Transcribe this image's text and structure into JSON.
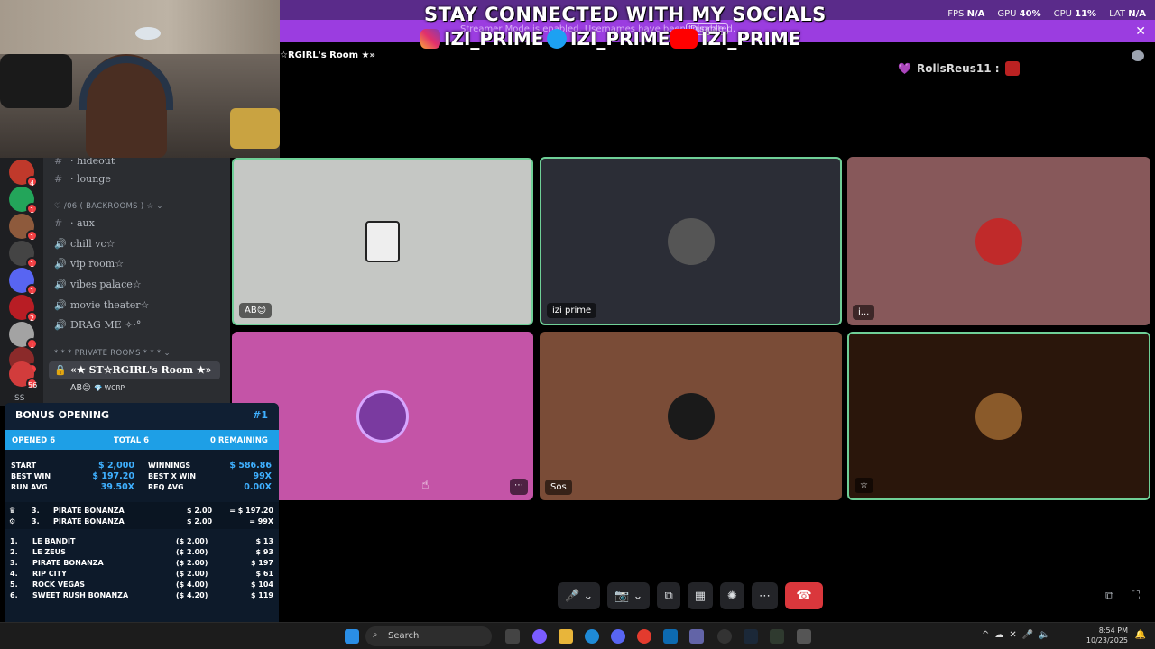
{
  "banner": {
    "title": "STAY CONNECTED WITH MY SOCIALS",
    "streamer_msg": "Streamer Mode is enabled. Usernames have been truncated.",
    "disable_label": "Disable",
    "socials": [
      "IZI_PRIME",
      "IZI_PRIME",
      "IZI_PRIME"
    ],
    "close_icon": "✕"
  },
  "stats": {
    "fps_label": "FPS",
    "fps_val": "N/A",
    "gpu_label": "GPU",
    "gpu_val": "40%",
    "cpu_label": "CPU",
    "cpu_val": "11%",
    "lat_label": "LAT",
    "lat_val": "N/A"
  },
  "server_rail": {
    "badges": [
      "4",
      "1",
      "1",
      "1",
      "1",
      "2",
      "1",
      "1",
      "56"
    ],
    "label": "SS"
  },
  "channels": {
    "items": [
      {
        "glyph": "#",
        "label": "· hideout"
      },
      {
        "glyph": "#",
        "label": "· lounge"
      },
      {
        "glyph": "#",
        "label": "· aux"
      },
      {
        "glyph": "🔊",
        "label": "chill vc☆"
      },
      {
        "glyph": "🔊",
        "label": "vip room☆"
      },
      {
        "glyph": "🔊",
        "label": "vibes palace☆"
      },
      {
        "glyph": "🔊",
        "label": "movie theater☆"
      },
      {
        "glyph": "🔊",
        "label": "DRAG ME ✧·°"
      }
    ],
    "cat_backrooms": "♡ /06 ( BACKROOMS ) ☆ ⌄",
    "cat_private": "* * * PRIVATE ROOMS * * * ⌄",
    "active_room": "«★ ST☆RGIRL's Room ★»",
    "member_name": "AB😊",
    "member_tag": "💎 WCRP"
  },
  "room_title": "☆RGIRL's Room ★»",
  "chat": {
    "user": "RollsReus11 :",
    "prefix": "💜"
  },
  "tiles": [
    {
      "name": "AB😊",
      "bg": "#c5c7c4"
    },
    {
      "name": "izi prime",
      "bg": "#2b2d36"
    },
    {
      "name": "i...",
      "bg": "#87585a"
    },
    {
      "name": "",
      "bg": "#c454a7"
    },
    {
      "name": "Sos",
      "bg": "#7a4c37"
    },
    {
      "name": "☆",
      "bg": "#2a160b"
    }
  ],
  "controls": {
    "mic_icon": "🎤",
    "video_icon": "📷",
    "share_icon": "⧉",
    "activity_icon": "▦",
    "soundboard_icon": "✺",
    "more_icon": "⋯",
    "hangup_icon": "☎",
    "popout_icon": "⧉",
    "fullscreen_icon": "⛶"
  },
  "bonus": {
    "title": "BONUS OPENING",
    "number": "#1",
    "opened": "OPENED 6",
    "total": "TOTAL 6",
    "remaining": "0 REMAINING",
    "stats": {
      "start_label": "START",
      "start_val": "$ 2,000",
      "winnings_label": "WINNINGS",
      "winnings_val": "$ 586.86",
      "bestwin_label": "BEST WIN",
      "bestwin_val": "$ 197.20",
      "bestx_label": "BEST X WIN",
      "bestx_val": "99X",
      "runavg_label": "RUN AVG",
      "runavg_val": "39.50X",
      "reqavg_label": "REQ AVG",
      "reqavg_val": "0.00X"
    },
    "best": [
      {
        "num": "3.",
        "name": "PIRATE BONANZA",
        "bet": "$ 2.00",
        "res": "= $ 197.20"
      },
      {
        "num": "3.",
        "name": "PIRATE BONANZA",
        "bet": "$ 2.00",
        "res": "= 99X"
      }
    ],
    "list": [
      {
        "num": "1.",
        "name": "LE BANDIT",
        "bet": "($ 2.00)",
        "win": "$ 13"
      },
      {
        "num": "2.",
        "name": "LE ZEUS",
        "bet": "($ 2.00)",
        "win": "$ 93"
      },
      {
        "num": "3.",
        "name": "PIRATE BONANZA",
        "bet": "($ 2.00)",
        "win": "$ 197"
      },
      {
        "num": "4.",
        "name": "RIP CITY",
        "bet": "($ 2.00)",
        "win": "$ 61"
      },
      {
        "num": "5.",
        "name": "ROCK VEGAS",
        "bet": "($ 4.00)",
        "win": "$ 104"
      },
      {
        "num": "6.",
        "name": "SWEET RUSH BONANZA",
        "bet": "($ 4.20)",
        "win": "$ 119"
      }
    ]
  },
  "taskbar": {
    "search_placeholder": "Search",
    "time": "8:54 PM",
    "date": "10/23/2025"
  }
}
